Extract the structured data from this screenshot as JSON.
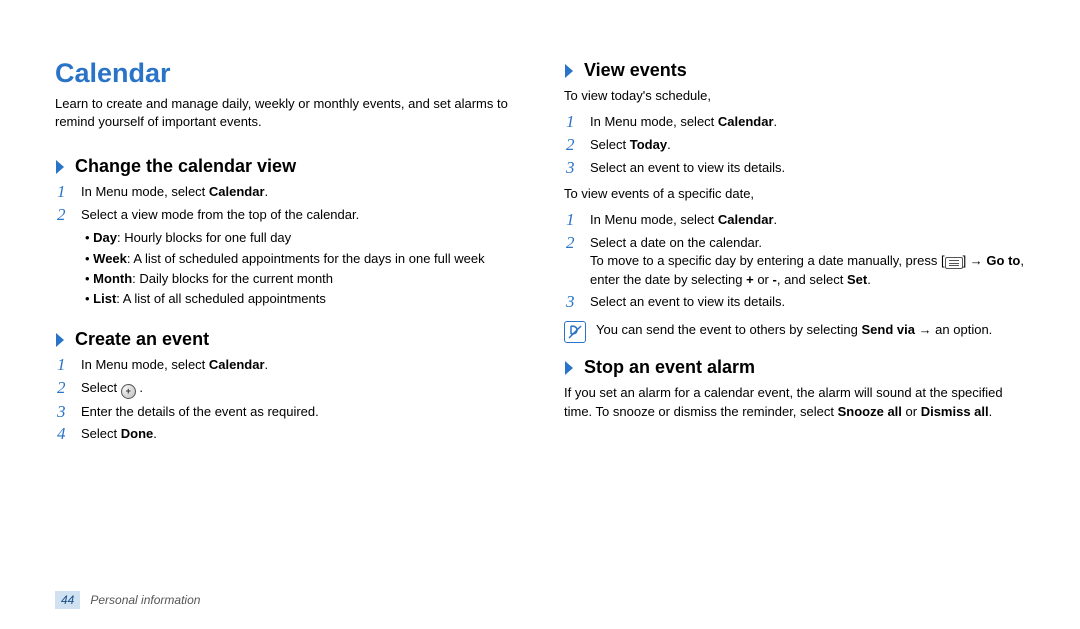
{
  "title": "Calendar",
  "intro": "Learn to create and manage daily, weekly or monthly events, and set alarms to remind yourself of important events.",
  "left": {
    "s1": {
      "heading": "Change the calendar view",
      "step1_pre": "In Menu mode, select ",
      "step1_bold": "Calendar",
      "step1_post": ".",
      "step2": "Select a view mode from the top of the calendar.",
      "b_day_t": "Day",
      "b_day_d": ": Hourly blocks for one full day",
      "b_week_t": "Week",
      "b_week_d": ": A list of scheduled appointments for the days in one full week",
      "b_month_t": "Month",
      "b_month_d": ": Daily blocks for the current month",
      "b_list_t": "List",
      "b_list_d": ": A list of all scheduled appointments"
    },
    "s2": {
      "heading": "Create an event",
      "step1_pre": "In Menu mode, select ",
      "step1_bold": "Calendar",
      "step1_post": ".",
      "step2_pre": "Select ",
      "step2_post": " .",
      "step3": "Enter the details of the event as required.",
      "step4_pre": "Select ",
      "step4_bold": "Done",
      "step4_post": "."
    }
  },
  "right": {
    "s3": {
      "heading": "View events",
      "desc_a": "To view today's schedule,",
      "a1_pre": "In Menu mode, select ",
      "a1_bold": "Calendar",
      "a1_post": ".",
      "a2_pre": "Select ",
      "a2_bold": "Today",
      "a2_post": ".",
      "a3": "Select an event to view its details.",
      "desc_b": "To view events of a specific date,",
      "b1_pre": "In Menu mode, select ",
      "b1_bold": "Calendar",
      "b1_post": ".",
      "b2": "Select a date on the calendar.",
      "b2_hint_pre": "To move to a specific day by entering a date manually, press [",
      "b2_hint_mid": "] → ",
      "b2_hint_goto": "Go to",
      "b2_hint_mid2": ", enter the date by selecting ",
      "b2_hint_plus": "+",
      "b2_hint_or": " or ",
      "b2_hint_minus": "-",
      "b2_hint_mid3": ", and select ",
      "b2_hint_set": "Set",
      "b2_hint_post": ".",
      "b3": "Select an event to view its details.",
      "note_pre": "You can send the event to others by selecting ",
      "note_bold": "Send via",
      "note_post": " → an option."
    },
    "s4": {
      "heading": "Stop an event alarm",
      "desc_pre": "If you set an alarm for a calendar event, the alarm will sound at the specified time. To snooze or dismiss the reminder, select ",
      "snooze": "Snooze all",
      "or": " or ",
      "dismiss": "Dismiss all",
      "post": "."
    }
  },
  "footer": {
    "page": "44",
    "section": "Personal information"
  },
  "labels": {
    "num1": "1",
    "num2": "2",
    "num3": "3",
    "num4": "4",
    "plus": "+"
  }
}
